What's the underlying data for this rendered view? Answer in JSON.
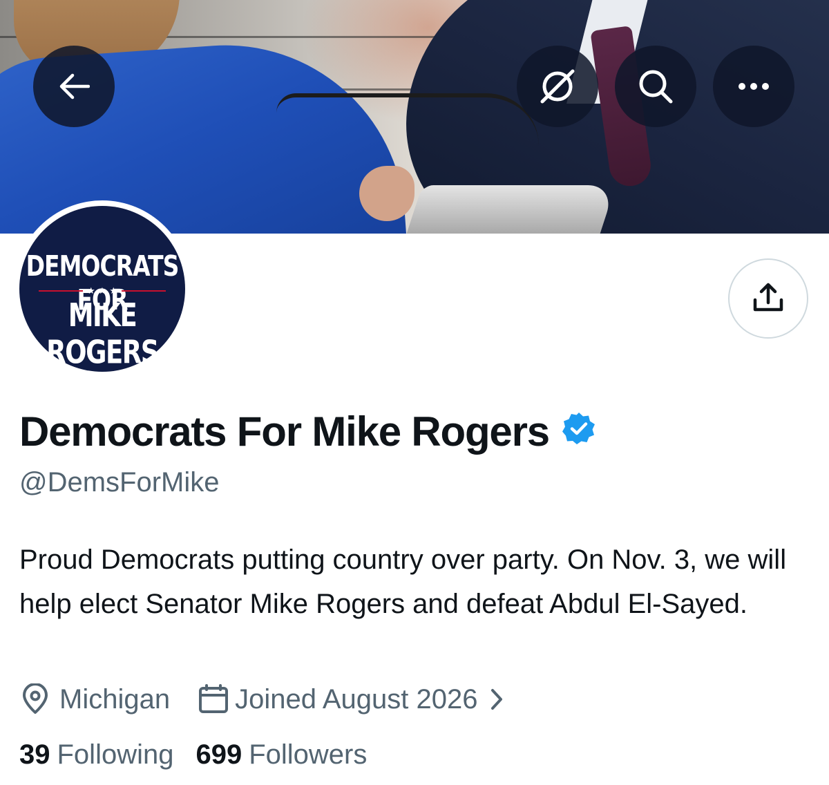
{
  "header": {
    "back_button": {
      "icon": "back-arrow-icon"
    },
    "grok_button": {
      "icon": "grok-icon"
    },
    "search_button": {
      "icon": "search-icon"
    },
    "more_button": {
      "icon": "more-horizontal-icon"
    }
  },
  "profile": {
    "avatar": {
      "line1": "DEMOCRATS FOR",
      "stars": "★ ★ ★",
      "line2": "MIKE ROGERS"
    },
    "share_button": {
      "icon": "share-icon"
    },
    "display_name": "Democrats For Mike Rogers",
    "verified_icon": "verified-badge-icon",
    "handle": "@DemsForMike",
    "bio": "Proud Democrats putting country over party. On Nov. 3, we will help elect Senator Mike Rogers and defeat Abdul El-Sayed.",
    "location": "Michigan",
    "location_icon": "location-pin-icon",
    "joined": "Joined August 2026",
    "joined_icon": "calendar-icon",
    "joined_chevron": "chevron-right-icon",
    "following_count": "39",
    "following_label": "Following",
    "followers_count": "699",
    "followers_label": "Followers"
  },
  "colors": {
    "accent": "#1d9bf0",
    "text_primary": "#0f1419",
    "text_secondary": "#536471",
    "avatar_bg": "#101c45",
    "avatar_rule": "#c8102e"
  }
}
